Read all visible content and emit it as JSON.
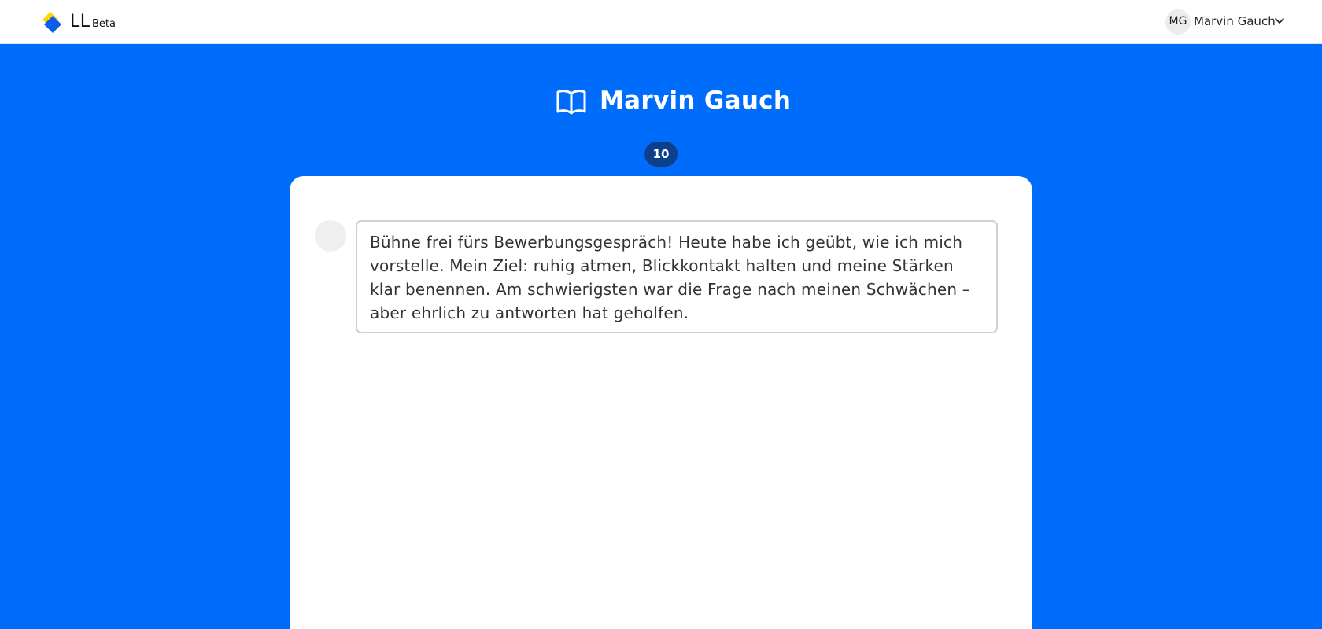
{
  "header": {
    "logo_name": "LL",
    "logo_badge": "Beta",
    "user_initials": "MG",
    "user_name": "Marvin Gauch",
    "icons": {
      "logo": "diamond-logo-icon",
      "menu": "chevron-down-icon"
    }
  },
  "main": {
    "title": "Marvin Gauch",
    "title_icon": "open-book-icon",
    "entry_count": "10",
    "entry_text": "Bühne frei fürs Bewerbungsgespräch! Heute habe ich geübt, wie ich mich vorstelle. Mein Ziel: ruhig atmen, Blickkontakt halten und meine Stärken klar benennen. Am schwierigsten war die Frage nach meinen Schwächen – aber ehrlich zu antworten hat geholfen."
  },
  "colors": {
    "background": "#006cfb",
    "badge": "#0d3f8a",
    "logo_blue": "#0b5ee8",
    "logo_yellow": "#ffd600",
    "card": "#ffffff"
  }
}
